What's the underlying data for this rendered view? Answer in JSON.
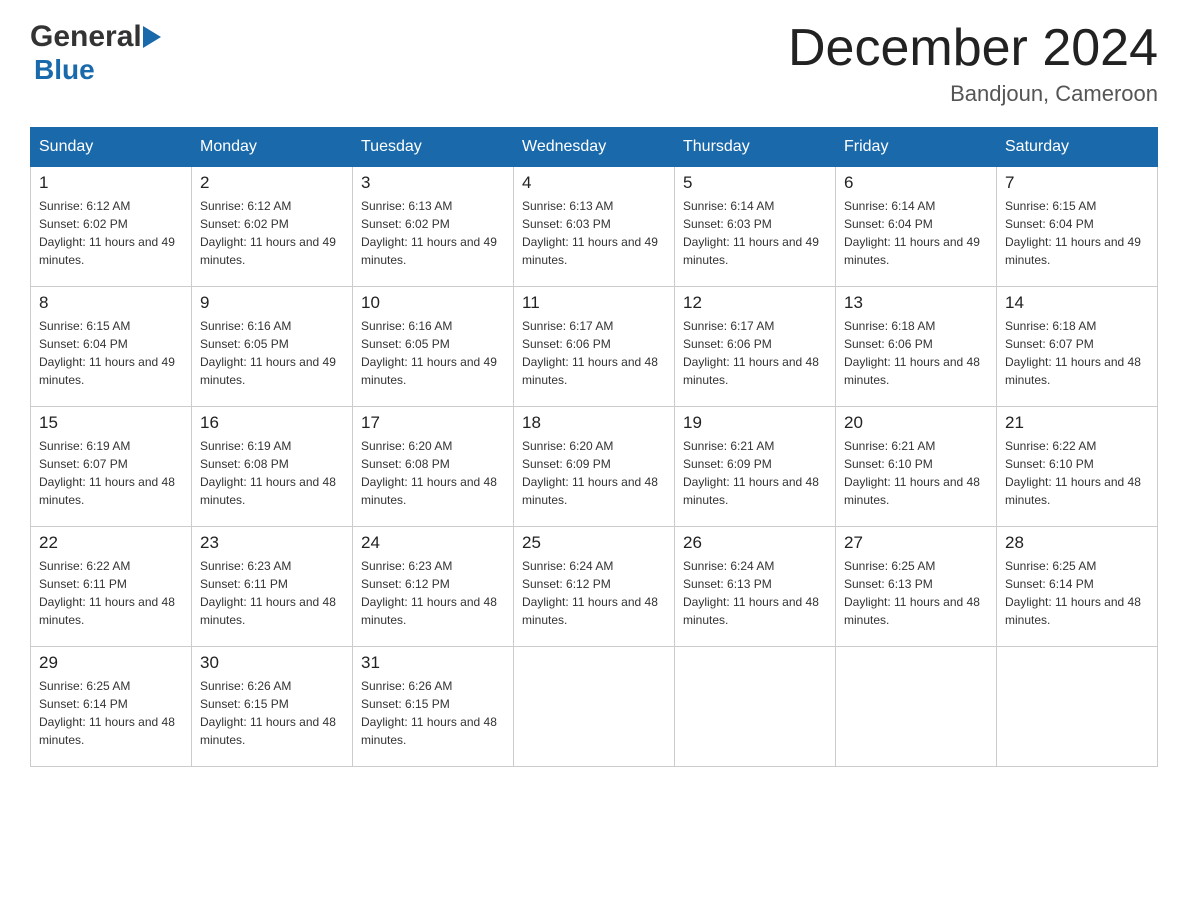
{
  "header": {
    "logo_general": "General",
    "logo_blue": "Blue",
    "month_title": "December 2024",
    "location": "Bandjoun, Cameroon"
  },
  "weekdays": [
    "Sunday",
    "Monday",
    "Tuesday",
    "Wednesday",
    "Thursday",
    "Friday",
    "Saturday"
  ],
  "weeks": [
    [
      {
        "day": "1",
        "sunrise": "Sunrise: 6:12 AM",
        "sunset": "Sunset: 6:02 PM",
        "daylight": "Daylight: 11 hours and 49 minutes."
      },
      {
        "day": "2",
        "sunrise": "Sunrise: 6:12 AM",
        "sunset": "Sunset: 6:02 PM",
        "daylight": "Daylight: 11 hours and 49 minutes."
      },
      {
        "day": "3",
        "sunrise": "Sunrise: 6:13 AM",
        "sunset": "Sunset: 6:02 PM",
        "daylight": "Daylight: 11 hours and 49 minutes."
      },
      {
        "day": "4",
        "sunrise": "Sunrise: 6:13 AM",
        "sunset": "Sunset: 6:03 PM",
        "daylight": "Daylight: 11 hours and 49 minutes."
      },
      {
        "day": "5",
        "sunrise": "Sunrise: 6:14 AM",
        "sunset": "Sunset: 6:03 PM",
        "daylight": "Daylight: 11 hours and 49 minutes."
      },
      {
        "day": "6",
        "sunrise": "Sunrise: 6:14 AM",
        "sunset": "Sunset: 6:04 PM",
        "daylight": "Daylight: 11 hours and 49 minutes."
      },
      {
        "day": "7",
        "sunrise": "Sunrise: 6:15 AM",
        "sunset": "Sunset: 6:04 PM",
        "daylight": "Daylight: 11 hours and 49 minutes."
      }
    ],
    [
      {
        "day": "8",
        "sunrise": "Sunrise: 6:15 AM",
        "sunset": "Sunset: 6:04 PM",
        "daylight": "Daylight: 11 hours and 49 minutes."
      },
      {
        "day": "9",
        "sunrise": "Sunrise: 6:16 AM",
        "sunset": "Sunset: 6:05 PM",
        "daylight": "Daylight: 11 hours and 49 minutes."
      },
      {
        "day": "10",
        "sunrise": "Sunrise: 6:16 AM",
        "sunset": "Sunset: 6:05 PM",
        "daylight": "Daylight: 11 hours and 49 minutes."
      },
      {
        "day": "11",
        "sunrise": "Sunrise: 6:17 AM",
        "sunset": "Sunset: 6:06 PM",
        "daylight": "Daylight: 11 hours and 48 minutes."
      },
      {
        "day": "12",
        "sunrise": "Sunrise: 6:17 AM",
        "sunset": "Sunset: 6:06 PM",
        "daylight": "Daylight: 11 hours and 48 minutes."
      },
      {
        "day": "13",
        "sunrise": "Sunrise: 6:18 AM",
        "sunset": "Sunset: 6:06 PM",
        "daylight": "Daylight: 11 hours and 48 minutes."
      },
      {
        "day": "14",
        "sunrise": "Sunrise: 6:18 AM",
        "sunset": "Sunset: 6:07 PM",
        "daylight": "Daylight: 11 hours and 48 minutes."
      }
    ],
    [
      {
        "day": "15",
        "sunrise": "Sunrise: 6:19 AM",
        "sunset": "Sunset: 6:07 PM",
        "daylight": "Daylight: 11 hours and 48 minutes."
      },
      {
        "day": "16",
        "sunrise": "Sunrise: 6:19 AM",
        "sunset": "Sunset: 6:08 PM",
        "daylight": "Daylight: 11 hours and 48 minutes."
      },
      {
        "day": "17",
        "sunrise": "Sunrise: 6:20 AM",
        "sunset": "Sunset: 6:08 PM",
        "daylight": "Daylight: 11 hours and 48 minutes."
      },
      {
        "day": "18",
        "sunrise": "Sunrise: 6:20 AM",
        "sunset": "Sunset: 6:09 PM",
        "daylight": "Daylight: 11 hours and 48 minutes."
      },
      {
        "day": "19",
        "sunrise": "Sunrise: 6:21 AM",
        "sunset": "Sunset: 6:09 PM",
        "daylight": "Daylight: 11 hours and 48 minutes."
      },
      {
        "day": "20",
        "sunrise": "Sunrise: 6:21 AM",
        "sunset": "Sunset: 6:10 PM",
        "daylight": "Daylight: 11 hours and 48 minutes."
      },
      {
        "day": "21",
        "sunrise": "Sunrise: 6:22 AM",
        "sunset": "Sunset: 6:10 PM",
        "daylight": "Daylight: 11 hours and 48 minutes."
      }
    ],
    [
      {
        "day": "22",
        "sunrise": "Sunrise: 6:22 AM",
        "sunset": "Sunset: 6:11 PM",
        "daylight": "Daylight: 11 hours and 48 minutes."
      },
      {
        "day": "23",
        "sunrise": "Sunrise: 6:23 AM",
        "sunset": "Sunset: 6:11 PM",
        "daylight": "Daylight: 11 hours and 48 minutes."
      },
      {
        "day": "24",
        "sunrise": "Sunrise: 6:23 AM",
        "sunset": "Sunset: 6:12 PM",
        "daylight": "Daylight: 11 hours and 48 minutes."
      },
      {
        "day": "25",
        "sunrise": "Sunrise: 6:24 AM",
        "sunset": "Sunset: 6:12 PM",
        "daylight": "Daylight: 11 hours and 48 minutes."
      },
      {
        "day": "26",
        "sunrise": "Sunrise: 6:24 AM",
        "sunset": "Sunset: 6:13 PM",
        "daylight": "Daylight: 11 hours and 48 minutes."
      },
      {
        "day": "27",
        "sunrise": "Sunrise: 6:25 AM",
        "sunset": "Sunset: 6:13 PM",
        "daylight": "Daylight: 11 hours and 48 minutes."
      },
      {
        "day": "28",
        "sunrise": "Sunrise: 6:25 AM",
        "sunset": "Sunset: 6:14 PM",
        "daylight": "Daylight: 11 hours and 48 minutes."
      }
    ],
    [
      {
        "day": "29",
        "sunrise": "Sunrise: 6:25 AM",
        "sunset": "Sunset: 6:14 PM",
        "daylight": "Daylight: 11 hours and 48 minutes."
      },
      {
        "day": "30",
        "sunrise": "Sunrise: 6:26 AM",
        "sunset": "Sunset: 6:15 PM",
        "daylight": "Daylight: 11 hours and 48 minutes."
      },
      {
        "day": "31",
        "sunrise": "Sunrise: 6:26 AM",
        "sunset": "Sunset: 6:15 PM",
        "daylight": "Daylight: 11 hours and 48 minutes."
      },
      null,
      null,
      null,
      null
    ]
  ]
}
